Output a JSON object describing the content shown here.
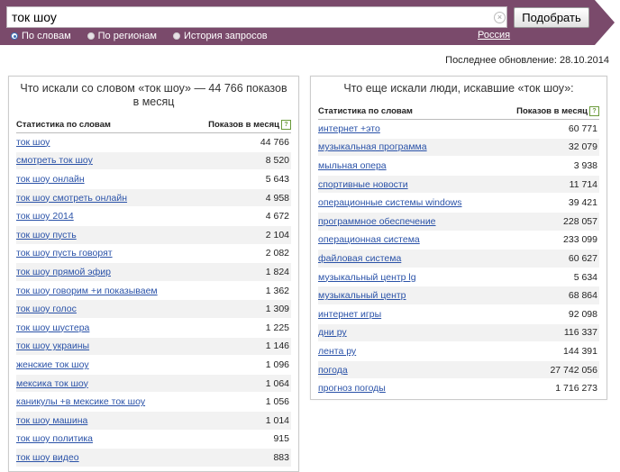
{
  "search": {
    "query": "ток шоу",
    "submit_label": "Подобрать",
    "clear_glyph": "×"
  },
  "modes": [
    {
      "label": "По словам",
      "checked": true
    },
    {
      "label": "По регионам",
      "checked": false
    },
    {
      "label": "История запросов",
      "checked": false
    }
  ],
  "region_label": "Россия",
  "last_update": "Последнее обновление: 28.10.2014",
  "left_panel": {
    "title": "Что искали со словом «ток шоу» — 44 766 показов в месяц",
    "col_query": "Статистика по словам",
    "col_count": "Показов в месяц",
    "help_glyph": "?",
    "rows": [
      {
        "q": "ток шоу",
        "n": "44 766"
      },
      {
        "q": "смотреть ток шоу",
        "n": "8 520"
      },
      {
        "q": "ток шоу онлайн",
        "n": "5 643"
      },
      {
        "q": "ток шоу смотреть онлайн",
        "n": "4 958"
      },
      {
        "q": "ток шоу 2014",
        "n": "4 672"
      },
      {
        "q": "ток шоу пусть",
        "n": "2 104"
      },
      {
        "q": "ток шоу пусть говорят",
        "n": "2 082"
      },
      {
        "q": "ток шоу прямой эфир",
        "n": "1 824"
      },
      {
        "q": "ток шоу говорим +и показываем",
        "n": "1 362"
      },
      {
        "q": "ток шоу голос",
        "n": "1 309"
      },
      {
        "q": "ток шоу шустера",
        "n": "1 225"
      },
      {
        "q": "ток шоу украины",
        "n": "1 146"
      },
      {
        "q": "женские ток шоу",
        "n": "1 096"
      },
      {
        "q": "мексика ток шоу",
        "n": "1 064"
      },
      {
        "q": "каникулы +в мексике ток шоу",
        "n": "1 056"
      },
      {
        "q": "ток шоу машина",
        "n": "1 014"
      },
      {
        "q": "ток шоу политика",
        "n": "915"
      },
      {
        "q": "ток шоу видео",
        "n": "883"
      }
    ]
  },
  "right_panel": {
    "title": "Что еще искали люди, искавшие «ток шоу»:",
    "col_query": "Статистика по словам",
    "col_count": "Показов в месяц",
    "help_glyph": "?",
    "rows": [
      {
        "q": "интернет +это",
        "n": "60 771"
      },
      {
        "q": "музыкальная программа",
        "n": "32 079"
      },
      {
        "q": "мыльная опера",
        "n": "3 938"
      },
      {
        "q": "спортивные новости",
        "n": "11 714"
      },
      {
        "q": "операционные системы windows",
        "n": "39 421"
      },
      {
        "q": "программное обеспечение",
        "n": "228 057"
      },
      {
        "q": "операционная система",
        "n": "233 099"
      },
      {
        "q": "файловая система",
        "n": "60 627"
      },
      {
        "q": "музыкальный центр lg",
        "n": "5 634"
      },
      {
        "q": "музыкальный центр",
        "n": "68 864"
      },
      {
        "q": "интернет игры",
        "n": "92 098"
      },
      {
        "q": "дни ру",
        "n": "116 337"
      },
      {
        "q": "лента ру",
        "n": "144 391"
      },
      {
        "q": "погода",
        "n": "27 742 056"
      },
      {
        "q": "прогноз погоды",
        "n": "1 716 273"
      }
    ]
  }
}
